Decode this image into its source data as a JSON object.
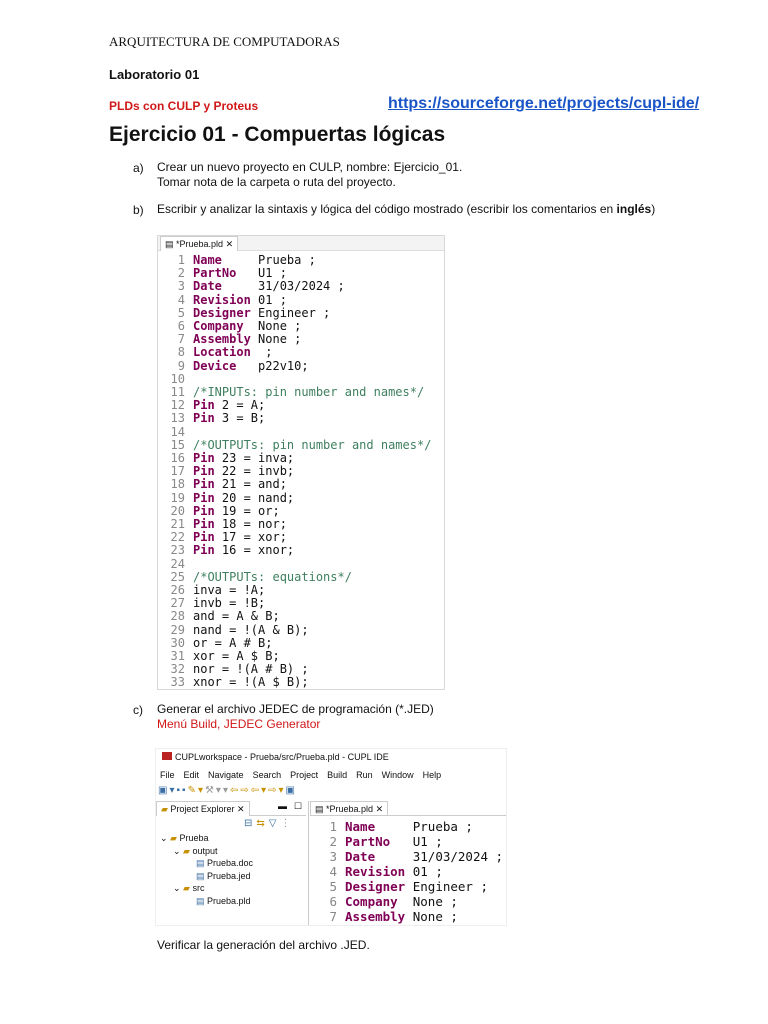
{
  "header": "ARQUITECTURA DE COMPUTADORAS",
  "lab": "Laboratorio 01",
  "subtitle": "PLDs con CULP y Proteus",
  "link": "https://sourceforge.net/projects/cupl-ide/",
  "title": "Ejercicio 01 - Compuertas lógicas",
  "steps": {
    "a": {
      "mark": "a)",
      "line1": "Crear un nuevo proyecto en CULP, nombre: Ejercicio_01.",
      "line2": "Tomar nota de la carpeta o ruta del proyecto."
    },
    "b": {
      "mark": "b)",
      "text": "Escribir y analizar la sintaxis y lógica del código mostrado (escribir los comentarios en ",
      "bold": "inglés",
      ")": ")",
      "close": ")"
    },
    "c": {
      "mark": "c)",
      "line1": "Generar el archivo JEDEC de programación (*.JED)",
      "line2": "Menú Build, JEDEC Generator"
    },
    "verify": "Verificar la generación del archivo .JED."
  },
  "editor": {
    "tab": "*Prueba.pld",
    "lines": [
      {
        "n": "1",
        "kw": "Name",
        "rest": "     Prueba ;"
      },
      {
        "n": "2",
        "kw": "PartNo",
        "rest": "   U1 ;"
      },
      {
        "n": "3",
        "kw": "Date",
        "rest": "     31/03/2024 ;"
      },
      {
        "n": "4",
        "kw": "Revision",
        "rest": " 01 ;"
      },
      {
        "n": "5",
        "kw": "Designer",
        "rest": " Engineer ;"
      },
      {
        "n": "6",
        "kw": "Company",
        "rest": "  None ;"
      },
      {
        "n": "7",
        "kw": "Assembly",
        "rest": " None ;"
      },
      {
        "n": "8",
        "kw": "Location",
        "rest": "  ;"
      },
      {
        "n": "9",
        "kw": "Device",
        "rest": "   p22v10;"
      },
      {
        "n": "10"
      },
      {
        "n": "11",
        "cm": "/*INPUTs: pin number and names*/"
      },
      {
        "n": "12",
        "kw": "Pin",
        "rest": " 2 = A;"
      },
      {
        "n": "13",
        "kw": "Pin",
        "rest": " 3 = B;"
      },
      {
        "n": "14"
      },
      {
        "n": "15",
        "cm": "/*OUTPUTs: pin number and names*/"
      },
      {
        "n": "16",
        "kw": "Pin",
        "rest": " 23 = inva;"
      },
      {
        "n": "17",
        "kw": "Pin",
        "rest": " 22 = invb;"
      },
      {
        "n": "18",
        "kw": "Pin",
        "rest": " 21 = and;"
      },
      {
        "n": "19",
        "kw": "Pin",
        "rest": " 20 = nand;"
      },
      {
        "n": "20",
        "kw": "Pin",
        "rest": " 19 = or;"
      },
      {
        "n": "21",
        "kw": "Pin",
        "rest": " 18 = nor;"
      },
      {
        "n": "22",
        "kw": "Pin",
        "rest": " 17 = xor;"
      },
      {
        "n": "23",
        "kw": "Pin",
        "rest": " 16 = xnor;"
      },
      {
        "n": "24"
      },
      {
        "n": "25",
        "cm": "/*OUTPUTs: equations*/"
      },
      {
        "n": "26",
        "rest": "inva = !A;"
      },
      {
        "n": "27",
        "rest": "invb = !B;"
      },
      {
        "n": "28",
        "rest": "and = A & B;"
      },
      {
        "n": "29",
        "rest": "nand = !(A & B);"
      },
      {
        "n": "30",
        "rest": "or = A # B;"
      },
      {
        "n": "31",
        "rest": "xor = A $ B;"
      },
      {
        "n": "32",
        "rest": "nor = !(A # B) ;"
      },
      {
        "n": "33",
        "rest": "xnor = !(A $ B);"
      }
    ]
  },
  "ide": {
    "window_title": "CUPLworkspace - Prueba/src/Prueba.pld - CUPL IDE",
    "menu": [
      "File",
      "Edit",
      "Navigate",
      "Search",
      "Project",
      "Build",
      "Run",
      "Window",
      "Help"
    ],
    "explorer_tab": "Project Explorer",
    "tree": [
      {
        "label": "Prueba",
        "depth": 0,
        "icon": "project-icon",
        "exp": "v"
      },
      {
        "label": "output",
        "depth": 1,
        "icon": "folder-icon",
        "exp": "v"
      },
      {
        "label": "Prueba.doc",
        "depth": 2,
        "icon": "file-icon",
        "exp": ""
      },
      {
        "label": "Prueba.jed",
        "depth": 2,
        "icon": "file-icon",
        "exp": ""
      },
      {
        "label": "src",
        "depth": 1,
        "icon": "folder-icon",
        "exp": "v"
      },
      {
        "label": "Prueba.pld",
        "depth": 2,
        "icon": "file-icon",
        "exp": ""
      }
    ],
    "editor_tab": "*Prueba.pld",
    "lines_count": 7
  }
}
